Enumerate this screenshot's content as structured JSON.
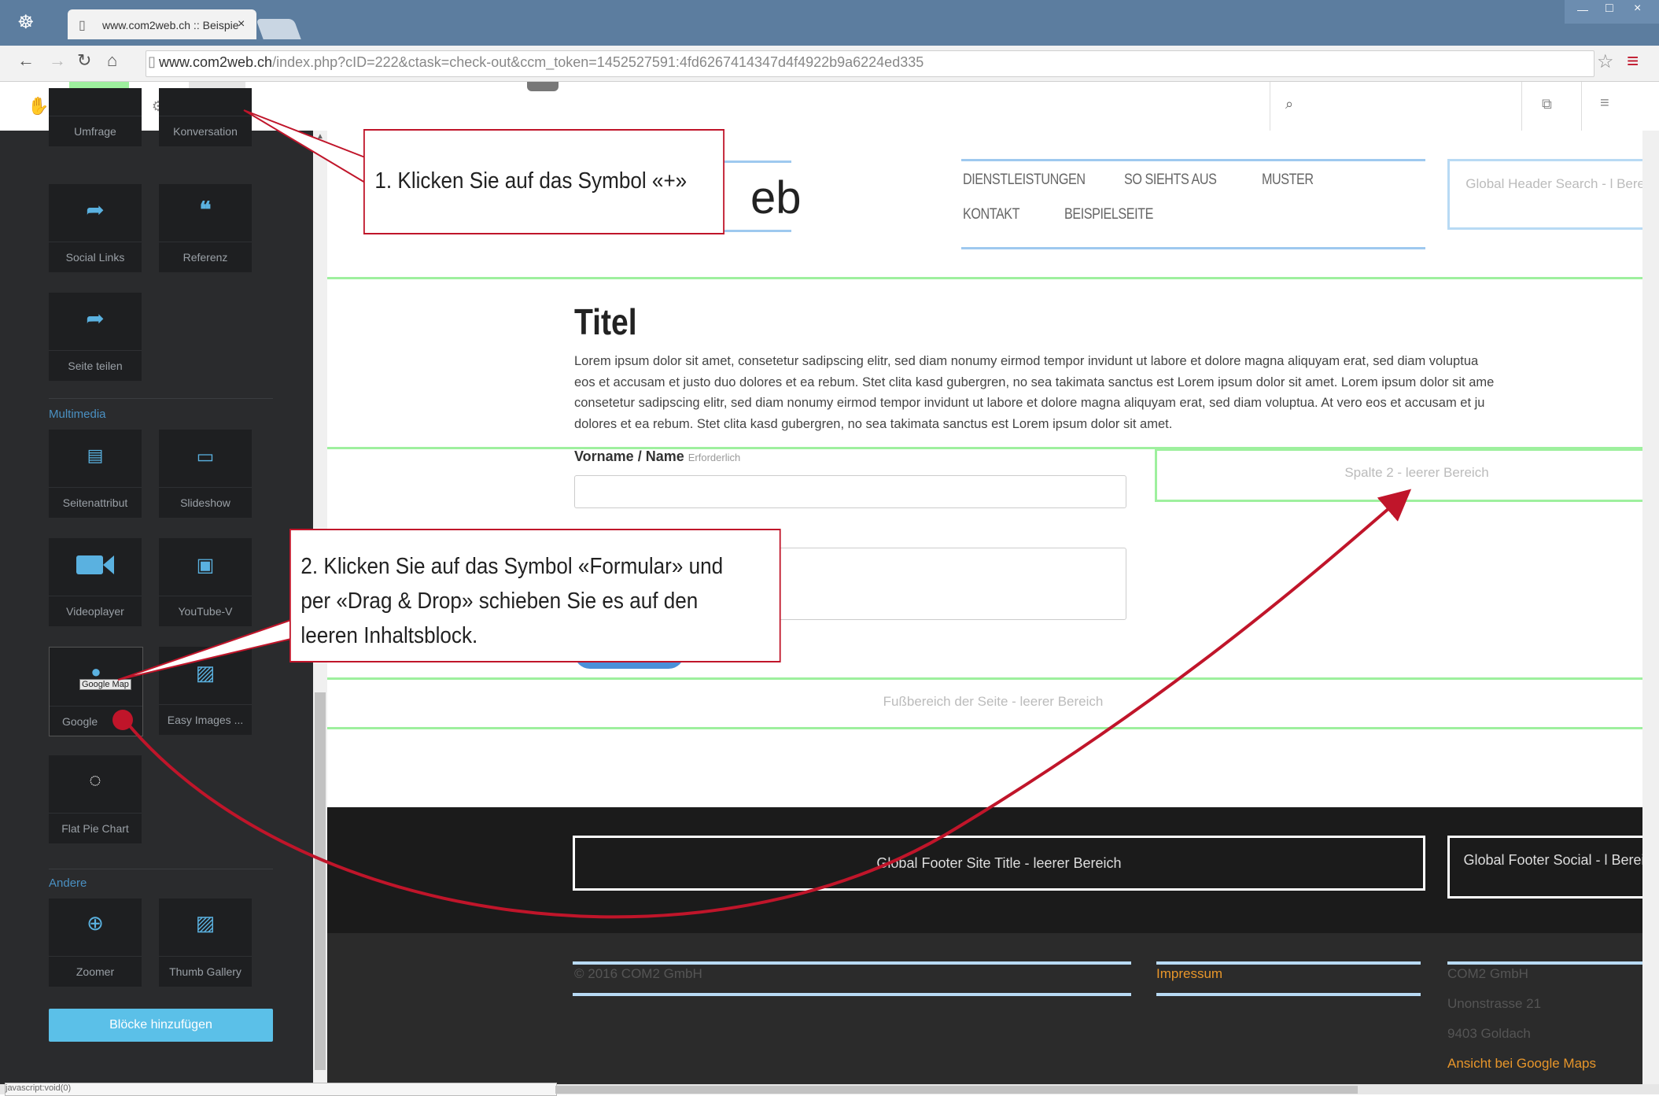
{
  "browser": {
    "tab_title": "www.com2web.ch :: Beispie",
    "url_host": "www.com2web.ch",
    "url_path": "/index.php?cID=222&ctask=check-out&ccm_token=1452527591:4fd6267414347d4f4922b9a6224ed335"
  },
  "sidebar": {
    "row0": [
      "Umfrage",
      "Konversation"
    ],
    "blocks_social": [
      {
        "label": "Social Links",
        "icon": "share-icon"
      },
      {
        "label": "Referenz",
        "icon": "quote-icon"
      },
      {
        "label": "Seite teilen",
        "icon": "share-icon"
      }
    ],
    "section_multimedia": "Multimedia",
    "blocks_multimedia": [
      {
        "label": "Seitenattribut",
        "icon": "list-icon"
      },
      {
        "label": "Slideshow",
        "icon": "slideshow-icon"
      },
      {
        "label": "Videoplayer",
        "icon": "video-icon"
      },
      {
        "label": "YouTube-V",
        "icon": "youtube-icon"
      },
      {
        "label": "Google",
        "icon": "map-pin-icon"
      },
      {
        "label": "Easy Images ...",
        "icon": "image-icon"
      },
      {
        "label": "Flat Pie Chart",
        "icon": "pie-chart-icon"
      }
    ],
    "tooltip": "Google Map",
    "section_other": "Andere",
    "blocks_other": [
      {
        "label": "Zoomer",
        "icon": "zoom-icon"
      },
      {
        "label": "Thumb Gallery",
        "icon": "gallery-icon"
      }
    ],
    "add_button": "Blöcke hinzufügen"
  },
  "page": {
    "logo_fragment": "eb",
    "nav": [
      "DIENSTLEISTUNGEN",
      "SO SIEHTS AUS",
      "MUSTER",
      "KONTAKT",
      "BEISPIELSEITE"
    ],
    "header_search": "Global Header Search - l Bereich",
    "title": "Titel",
    "lorem_lines": [
      "Lorem ipsum dolor sit amet, consetetur sadipscing elitr, sed diam nonumy eirmod tempor invidunt ut labore et dolore magna aliquyam erat, sed diam voluptua",
      "eos et accusam et justo duo dolores et ea rebum. Stet clita kasd gubergren, no sea takimata sanctus est Lorem ipsum dolor sit amet. Lorem ipsum dolor sit ame",
      "consetetur sadipscing elitr, sed diam nonumy eirmod tempor invidunt ut labore et dolore magna aliquyam erat, sed diam voluptua. At vero eos et accusam et ju",
      "dolores et ea rebum. Stet clita kasd gubergren, no sea takimata sanctus est Lorem ipsum dolor sit amet."
    ],
    "form_label": "Vorname / Name",
    "form_required": "Erforderlich",
    "column2": "Spalte 2 - leerer Bereich",
    "page_footer": "Fußbereich der Seite - leerer Bereich",
    "footer_site_title": "Global Footer Site Title - leerer Bereich",
    "footer_social": "Global Footer Social - l Bereich",
    "copyright": "© 2016 COM2 GmbH",
    "impressum": "Impressum",
    "address": [
      "COM2 GmbH",
      "Unonstrasse 21",
      "9403 Goldach"
    ],
    "maps_link": "Ansicht bei Google Maps"
  },
  "status": "javascript:void(0)",
  "callouts": {
    "step1": "1. Klicken Sie auf das Symbol «+»",
    "step2_lines": [
      "2. Klicken Sie auf das Symbol «Formular» und",
      "per «Drag & Drop» schieben Sie es auf den",
      "leeren Inhaltsblock."
    ]
  },
  "colors": {
    "accent_red": "#c0152a",
    "sidebar_bg": "#2a2b2d",
    "icon_blue": "#5ab1e0",
    "highlight_green": "#9ef09e",
    "link_orange": "#e8962a"
  }
}
